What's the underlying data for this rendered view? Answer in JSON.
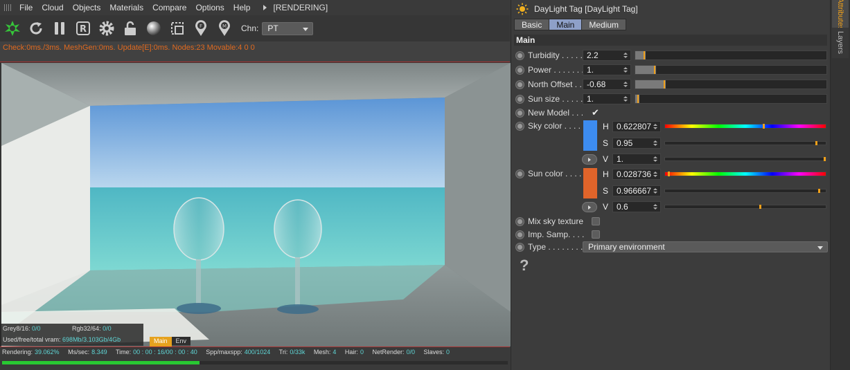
{
  "menu": {
    "items": [
      "File",
      "Cloud",
      "Objects",
      "Materials",
      "Compare",
      "Options",
      "Help"
    ],
    "render_status": "[RENDERING]"
  },
  "toolbar": {
    "icons": [
      "octane-logo-icon",
      "restart-icon",
      "pause-icon",
      "region-render-icon",
      "settings-gear-icon",
      "lock-icon",
      "material-sphere-icon",
      "pick-focus-icon",
      "focus-pin-icon",
      "material-pin-icon"
    ],
    "chn_label": "Chn:",
    "chn_value": "PT"
  },
  "status": {
    "line": "Check:0ms./3ms. MeshGen:0ms. Update[E]:0ms. Nodes:23 Movable:4  0 0"
  },
  "viewport_info": {
    "grey_label": "Grey8/16:",
    "grey_value": "0/0",
    "rgb_label": "Rgb32/64:",
    "rgb_value": "0/0",
    "vram_label": "Used/free/total vram:",
    "vram_value": "698Mb/3.103Gb/4Gb",
    "tabs": [
      "Main",
      "Env"
    ],
    "active_tab": "Main"
  },
  "bottom": {
    "stats": [
      {
        "k": "Rendering:",
        "v": "39.062%"
      },
      {
        "k": "Ms/sec:",
        "v": "8.349"
      },
      {
        "k": "Time:",
        "v": "00 : 00 : 16/00 : 00 : 40"
      },
      {
        "k": "Spp/maxspp:",
        "v": "400/1024"
      },
      {
        "k": "Tri:",
        "v": "0/33k"
      },
      {
        "k": "Mesh:",
        "v": "4"
      },
      {
        "k": "Hair:",
        "v": "0"
      },
      {
        "k": "NetRender:",
        "v": "0/0"
      },
      {
        "k": "Slaves:",
        "v": "0"
      }
    ],
    "progress_fraction": 0.39062
  },
  "attributes": {
    "tag_title": "DayLight Tag [DayLight Tag]",
    "tabs": [
      "Basic",
      "Main",
      "Medium"
    ],
    "active_tab": "Main",
    "section": "Main",
    "turbidity": {
      "label": "Turbidity . . . . .",
      "value": "2.2",
      "slider": 0.055
    },
    "power": {
      "label": "Power . . . . . . .",
      "value": "1.",
      "slider": 0.11
    },
    "north_offset": {
      "label": "North Offset . .",
      "value": "-0.68",
      "slider": 0.16
    },
    "sun_size": {
      "label": "Sun size . . . . .",
      "value": "1.",
      "slider": 0.02
    },
    "new_model": {
      "label": "New Model . . .",
      "checked": true
    },
    "sky_color": {
      "label": "Sky color  . . . .",
      "color": "#3d8cf0",
      "h_label": "H",
      "h": "0.622807",
      "h_frac": 0.622807,
      "s_label": "S",
      "s": "0.95",
      "s_frac": 0.95,
      "v_label": "V",
      "v": "1.",
      "v_frac": 1.0
    },
    "sun_color": {
      "label": "Sun color  . . . .",
      "color": "#e0642a",
      "h_label": "H",
      "h": "0.028736",
      "h_frac": 0.028736,
      "s_label": "S",
      "s": "0.966667",
      "s_frac": 0.966667,
      "v_label": "V",
      "v": "0.6",
      "v_frac": 0.6
    },
    "mix_sky_texture": {
      "label": "Mix sky texture",
      "checked": false
    },
    "imp_samp": {
      "label": "Imp. Samp. . . .",
      "checked": false
    },
    "type": {
      "label": "Type  . . . . . . . .",
      "value": "Primary environment"
    },
    "help_glyph": "?"
  },
  "side_tabs": {
    "attributes": "Attributes",
    "layers": "Layers"
  },
  "colors": {
    "accent": "#f0a01a",
    "status_orange": "#e06a20",
    "info_cyan": "#5fd6d6",
    "progress_green": "#28c832"
  }
}
